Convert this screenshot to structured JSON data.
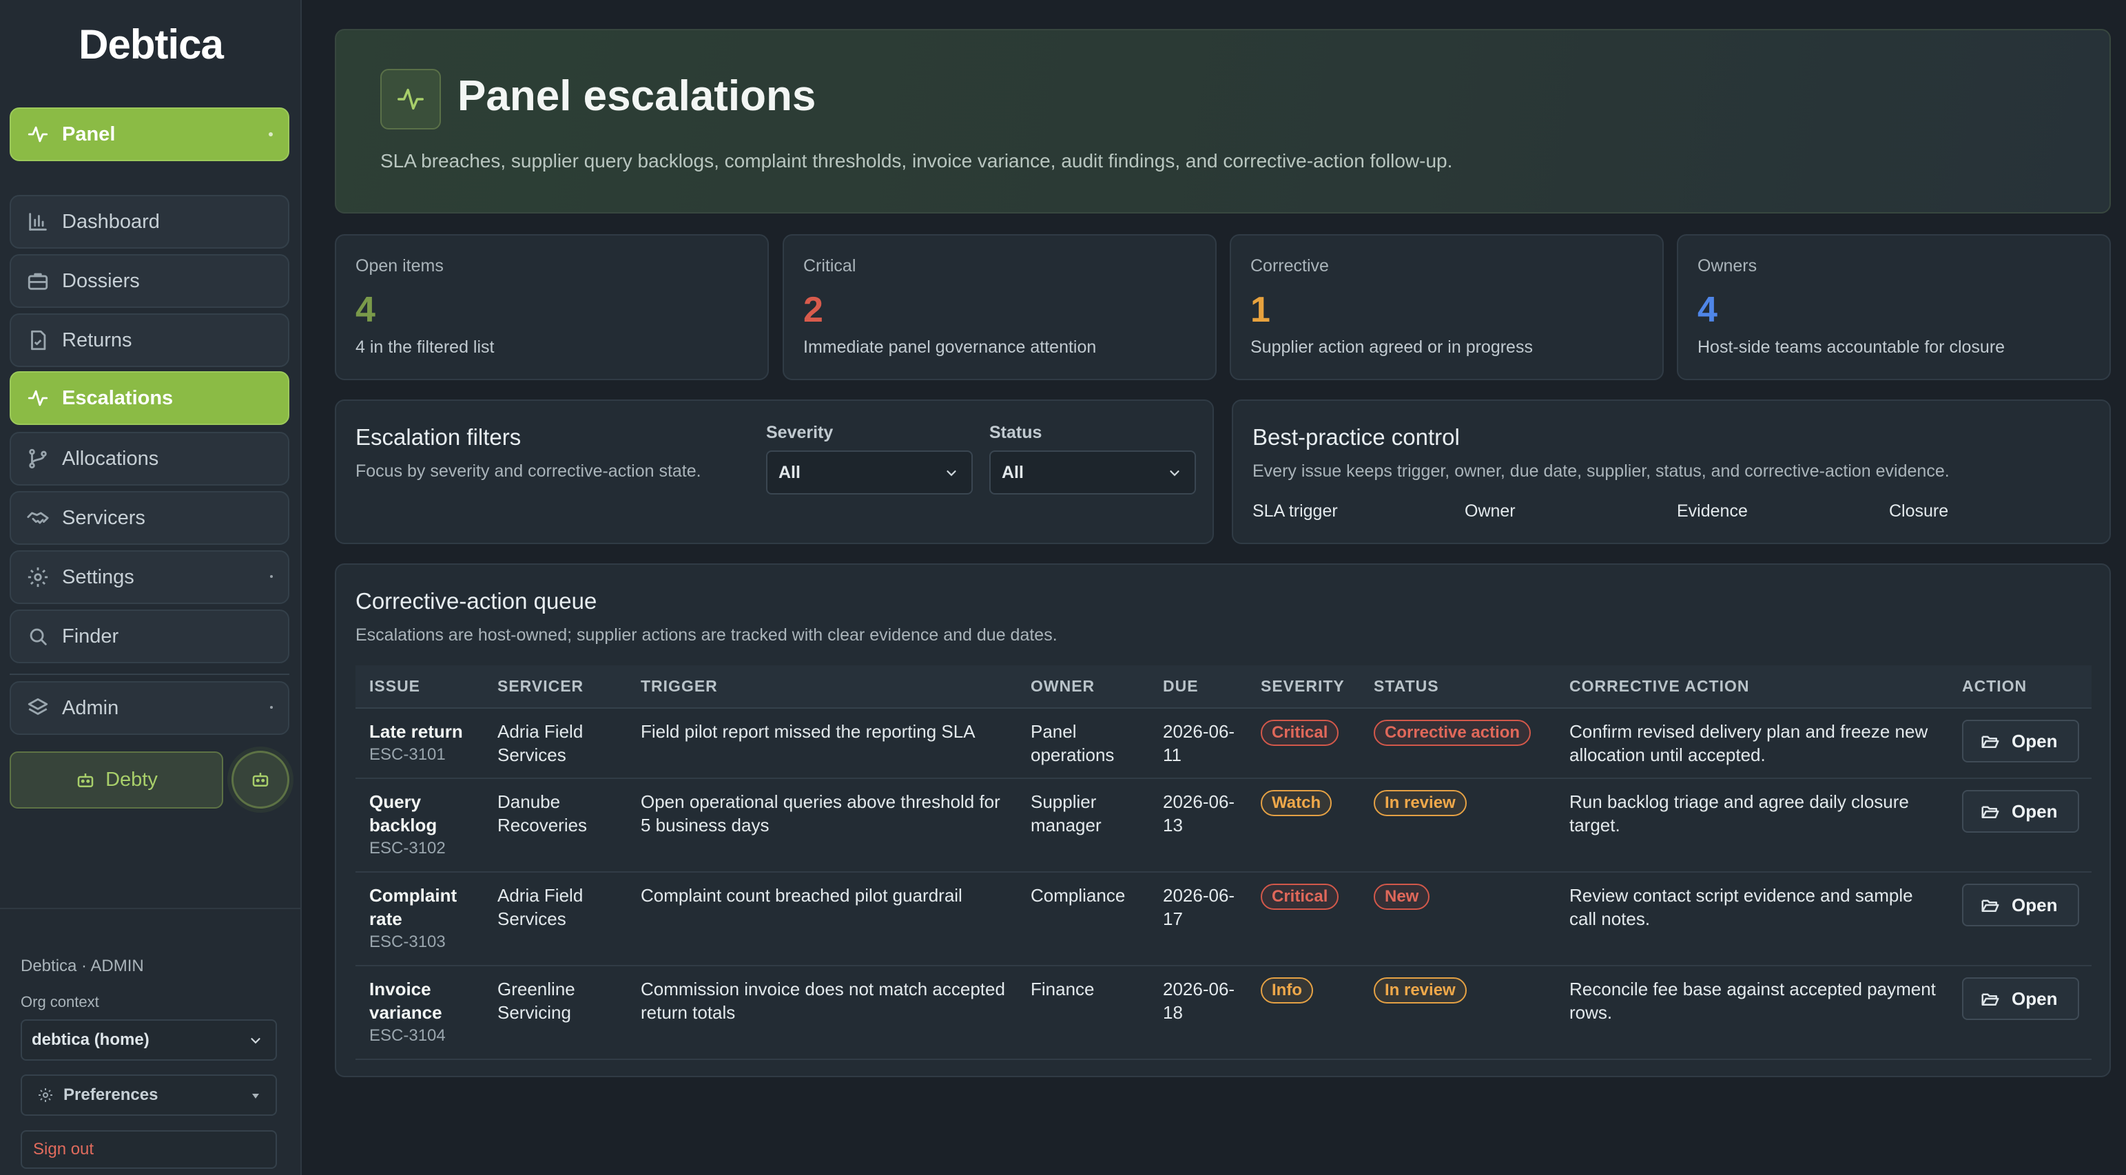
{
  "sidebar": {
    "brand": "Debtica",
    "nav": [
      {
        "label": "Panel",
        "icon": "activity-icon"
      },
      {
        "label": "Dashboard",
        "icon": "bar-chart-icon"
      },
      {
        "label": "Dossiers",
        "icon": "briefcase-icon"
      },
      {
        "label": "Returns",
        "icon": "document-icon"
      },
      {
        "label": "Escalations",
        "icon": "activity-icon"
      },
      {
        "label": "Allocations",
        "icon": "branch-icon"
      },
      {
        "label": "Servicers",
        "icon": "handshake-icon"
      },
      {
        "label": "Settings",
        "icon": "gear-icon"
      },
      {
        "label": "Finder",
        "icon": "search-icon"
      },
      {
        "label": "Admin",
        "icon": "layers-icon"
      }
    ],
    "debty_label": "Debty",
    "footer": {
      "account": "Debtica · ADMIN",
      "org_context_label": "Org context",
      "org_value": "debtica (home)",
      "preferences_label": "Preferences",
      "sign_out_label": "Sign out"
    }
  },
  "hero": {
    "title": "Panel escalations",
    "subtitle": "SLA breaches, supplier query backlogs, complaint thresholds, invoice variance, audit findings, and corrective-action follow-up."
  },
  "stats": [
    {
      "label": "Open items",
      "value": "4",
      "desc": "4 in the filtered list",
      "color": "#7a9a4a"
    },
    {
      "label": "Critical",
      "value": "2",
      "desc": "Immediate panel governance attention",
      "color": "#d85b4c"
    },
    {
      "label": "Corrective",
      "value": "1",
      "desc": "Supplier action agreed or in progress",
      "color": "#e7a23e"
    },
    {
      "label": "Owners",
      "value": "4",
      "desc": "Host-side teams accountable for closure",
      "color": "#4f86e8"
    }
  ],
  "filters": {
    "title": "Escalation filters",
    "subtitle": "Focus by severity and corrective-action state.",
    "severity_label": "Severity",
    "severity_value": "All",
    "status_label": "Status",
    "status_value": "All"
  },
  "best_practice": {
    "title": "Best-practice control",
    "subtitle": "Every issue keeps trigger, owner, due date, supplier, status, and corrective-action evidence.",
    "items": [
      "SLA trigger",
      "Owner",
      "Evidence",
      "Closure"
    ]
  },
  "queue": {
    "title": "Corrective-action queue",
    "subtitle": "Escalations are host-owned; supplier actions are tracked with clear evidence and due dates.",
    "columns": [
      "ISSUE",
      "SERVICER",
      "TRIGGER",
      "OWNER",
      "DUE",
      "SEVERITY",
      "STATUS",
      "CORRECTIVE ACTION",
      "ACTION"
    ],
    "open_label": "Open",
    "rows": [
      {
        "issue": "Late return",
        "code": "ESC-3101",
        "servicer": "Adria Field Services",
        "trigger": "Field pilot report missed the reporting SLA",
        "owner": "Panel operations",
        "due": "2026-06-11",
        "severity": "Critical",
        "severity_color": "red",
        "status": "Corrective action",
        "status_color": "red",
        "action": "Confirm revised delivery plan and freeze new allocation until accepted."
      },
      {
        "issue": "Query backlog",
        "code": "ESC-3102",
        "servicer": "Danube Recoveries",
        "trigger": "Open operational queries above threshold for 5 business days",
        "owner": "Supplier manager",
        "due": "2026-06-13",
        "severity": "Watch",
        "severity_color": "amber",
        "status": "In review",
        "status_color": "amber",
        "action": "Run backlog triage and agree daily closure target."
      },
      {
        "issue": "Complaint rate",
        "code": "ESC-3103",
        "servicer": "Adria Field Services",
        "trigger": "Complaint count breached pilot guardrail",
        "owner": "Compliance",
        "due": "2026-06-17",
        "severity": "Critical",
        "severity_color": "red",
        "status": "New",
        "status_color": "red",
        "action": "Review contact script evidence and sample call notes."
      },
      {
        "issue": "Invoice variance",
        "code": "ESC-3104",
        "servicer": "Greenline Servicing",
        "trigger": "Commission invoice does not match accepted return totals",
        "owner": "Finance",
        "due": "2026-06-18",
        "severity": "Info",
        "severity_color": "amber",
        "status": "In review",
        "status_color": "amber",
        "action": "Reconcile fee base against accepted payment rows."
      }
    ]
  }
}
